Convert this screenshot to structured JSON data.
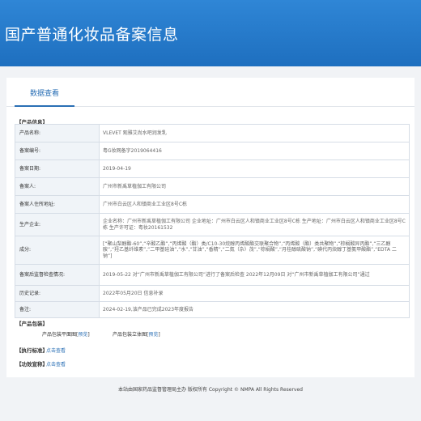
{
  "header": {
    "title": "国产普通化妆品备案信息"
  },
  "tabs": [
    {
      "label": "数据查看"
    }
  ],
  "product_info": {
    "section_title": "【产品信息】",
    "rows": [
      {
        "label": "产品名称:",
        "value": "VLEVET 观雅艾尚水吧润发乳"
      },
      {
        "label": "备案编号:",
        "value": "粤G妆网备字2019064416"
      },
      {
        "label": "备案日期:",
        "value": "2019-04-19"
      },
      {
        "label": "备案人:",
        "value": "广州市新禹草植伽工有限公司"
      },
      {
        "label": "备案人住所地址:",
        "value": "广州市白云区人和镇商业工业区8号C栋"
      },
      {
        "label": "生产企业:",
        "value": "企业名称：广州市新禹草植伽工有限公司 企业地址：广州市白云区人和镇商业工业区8号C栋 生产地址：广州市白云区人和镇商业工业区8号C栋 生产许可证：粤妆20161532"
      },
      {
        "label": "成分:",
        "value": "[“聚山梨醇酯-60”,“辛酸乙酯”,“丙烯酸（酯）类/C10-30烷醇丙烯酸酯交联聚合物”,“丙烯酸（酯）类共聚物”,“棕榈酸异丙酯”,“三乙醇胺”,“羟乙基纤维素”,“二甲基硅油”,“水”,“甘油”,“香精”,“二氮（杂）茂”,“棕榈酸”,“月桂醇硫酸钠”,“碘代丙炔醇丁基氨甲酸酯”,“EDTA 二钠”]"
      },
      {
        "label": "备案后监督检查情况:",
        "value": "2019-05-22 对“广州市新禹草植伽工有限公司”进行了备案后检查 2022年12月09日 对“广州市新禹草植伽工有限公司”通过"
      },
      {
        "label": "历史记录:",
        "value": "2022年05月20日 信息补录"
      },
      {
        "label": "备注:",
        "value": "2024-02-19,该产品已完成2023年度报告"
      }
    ]
  },
  "packaging": {
    "section_title": "【产品包装】",
    "items": [
      {
        "label": "产品包装平面图",
        "link": "预览"
      },
      {
        "label": "产品包装立体图",
        "link": "预览"
      }
    ]
  },
  "standard": {
    "section_title": "【执行标准】",
    "link": "点击查看"
  },
  "efficacy": {
    "section_title": "【功效宣称】",
    "link": "点击查看"
  },
  "footer": {
    "text": "本站由国家药品监督管理局主办 版权所有 Copyright © NMPA All Rights Reserved"
  }
}
